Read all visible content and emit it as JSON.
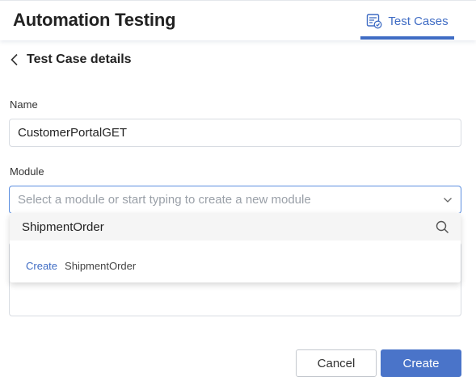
{
  "header": {
    "app_title": "Automation Testing",
    "tab_label": "Test Cases",
    "accent_color": "#3f6cc4",
    "tab_icon": "test-cases-icon"
  },
  "page": {
    "title": "Test Case details",
    "back_icon": "chevron-left-icon"
  },
  "form": {
    "name_label": "Name",
    "name_value": "CustomerPortalGET",
    "module_label": "Module",
    "module_placeholder": "Select a module or start typing to create a new module",
    "module_icon": "chevron-down-icon"
  },
  "dropdown": {
    "search_value": "ShipmentOrder",
    "search_icon": "search-icon",
    "option_action": "Create",
    "option_value": "ShipmentOrder"
  },
  "buttons": {
    "cancel": "Cancel",
    "create": "Create",
    "create_color": "#4a74c9"
  }
}
